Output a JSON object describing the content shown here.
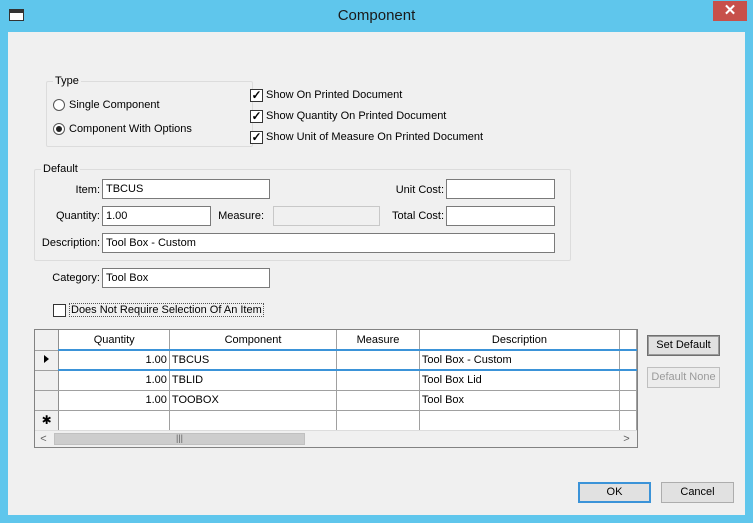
{
  "window": {
    "title": "Component",
    "close_glyph": "✕"
  },
  "type_group": {
    "legend": "Type",
    "options": [
      {
        "label": "Single Component",
        "selected": false
      },
      {
        "label": "Component With Options",
        "selected": true
      }
    ]
  },
  "print_options": [
    {
      "label": "Show On Printed Document",
      "checked": true
    },
    {
      "label": "Show Quantity On Printed Document",
      "checked": true
    },
    {
      "label": "Show Unit of Measure On Printed Document",
      "checked": true
    }
  ],
  "default_group": {
    "legend": "Default",
    "item_label": "Item:",
    "item_value": "TBCUS",
    "unit_cost_label": "Unit Cost:",
    "unit_cost_value": "",
    "quantity_label": "Quantity:",
    "quantity_value": "1.00",
    "measure_label": "Measure:",
    "measure_value": "",
    "total_cost_label": "Total Cost:",
    "total_cost_value": "",
    "description_label": "Description:",
    "description_value": "Tool Box - Custom"
  },
  "category": {
    "label": "Category:",
    "value": "Tool Box"
  },
  "no_selection": {
    "label": "Does Not Require Selection Of An Item",
    "checked": false
  },
  "grid": {
    "columns": [
      "Quantity",
      "Component",
      "Measure",
      "Description"
    ],
    "rows": [
      {
        "quantity": "1.00",
        "component": "TBCUS",
        "measure": "",
        "description": "Tool Box - Custom",
        "current": true
      },
      {
        "quantity": "1.00",
        "component": "TBLID",
        "measure": "",
        "description": "Tool Box Lid",
        "current": false
      },
      {
        "quantity": "1.00",
        "component": "TOOBOX",
        "measure": "",
        "description": "Tool Box",
        "current": false
      }
    ],
    "new_row_glyph": "✱",
    "scroll_left": "<",
    "scroll_right": ">",
    "thumb_grip": "|||"
  },
  "buttons": {
    "set_default": "Set Default",
    "default_none": "Default None",
    "ok": "OK",
    "cancel": "Cancel"
  }
}
